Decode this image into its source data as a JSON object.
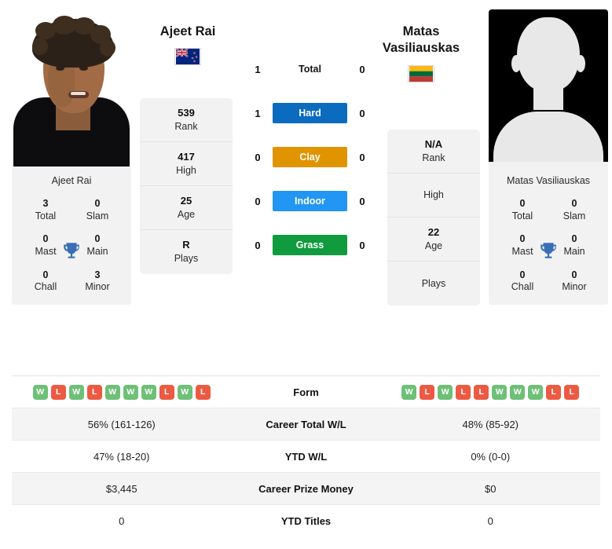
{
  "players": {
    "left": {
      "name": "Ajeet Rai",
      "photo_caption": "Ajeet Rai",
      "flag": "new-zealand-flag",
      "flag_country": "New Zealand",
      "titles": [
        {
          "value": "3",
          "label": "Total"
        },
        {
          "value": "0",
          "label": "Slam"
        },
        {
          "value": "0",
          "label": "Mast"
        },
        {
          "value": "0",
          "label": "Main"
        },
        {
          "value": "0",
          "label": "Chall"
        },
        {
          "value": "3",
          "label": "Minor"
        }
      ],
      "info": [
        {
          "value": "539",
          "label": "Rank"
        },
        {
          "value": "417",
          "label": "High"
        },
        {
          "value": "25",
          "label": "Age"
        },
        {
          "value": "R",
          "label": "Plays"
        }
      ],
      "form": [
        "W",
        "L",
        "W",
        "L",
        "W",
        "W",
        "W",
        "L",
        "W",
        "L"
      ],
      "career_total_wl": "56% (161-126)",
      "ytd_wl": "47% (18-20)",
      "career_prize_money": "$3,445",
      "ytd_titles": "0"
    },
    "right": {
      "name": "Matas Vasiliauskas",
      "name_line1": "Matas",
      "name_line2": "Vasiliauskas",
      "photo_caption": "Matas Vasiliauskas",
      "flag": "lithuania-flag",
      "flag_country": "Lithuania",
      "titles": [
        {
          "value": "0",
          "label": "Total"
        },
        {
          "value": "0",
          "label": "Slam"
        },
        {
          "value": "0",
          "label": "Mast"
        },
        {
          "value": "0",
          "label": "Main"
        },
        {
          "value": "0",
          "label": "Chall"
        },
        {
          "value": "0",
          "label": "Minor"
        }
      ],
      "info": [
        {
          "value": "N/A",
          "label": "Rank"
        },
        {
          "value": "",
          "label": "High"
        },
        {
          "value": "22",
          "label": "Age"
        },
        {
          "value": "",
          "label": "Plays"
        }
      ],
      "form": [
        "W",
        "L",
        "W",
        "L",
        "L",
        "W",
        "W",
        "W",
        "L",
        "L"
      ],
      "career_total_wl": "48% (85-92)",
      "ytd_wl": "0% (0-0)",
      "career_prize_money": "$0",
      "ytd_titles": "0"
    }
  },
  "head_to_head": [
    {
      "label": "Total",
      "left": "1",
      "right": "0",
      "badge": false,
      "color": ""
    },
    {
      "label": "Hard",
      "left": "1",
      "right": "0",
      "badge": true,
      "color": "#0B6BBF"
    },
    {
      "label": "Clay",
      "left": "0",
      "right": "0",
      "badge": true,
      "color": "#E09400"
    },
    {
      "label": "Indoor",
      "left": "0",
      "right": "0",
      "badge": true,
      "color": "#2196F3"
    },
    {
      "label": "Grass",
      "left": "0",
      "right": "0",
      "badge": true,
      "color": "#109B3E"
    }
  ],
  "comparison_rows": [
    {
      "label": "Form",
      "type": "form"
    },
    {
      "label": "Career Total W/L",
      "type": "text",
      "left": "56% (161-126)",
      "right": "48% (85-92)"
    },
    {
      "label": "YTD W/L",
      "type": "text",
      "left": "47% (18-20)",
      "right": "0% (0-0)"
    },
    {
      "label": "Career Prize Money",
      "type": "text",
      "left": "$3,445",
      "right": "$0"
    },
    {
      "label": "YTD Titles",
      "type": "text",
      "left": "0",
      "right": "0"
    }
  ],
  "colors": {
    "win": "#6ec077",
    "loss": "#ec5a43",
    "hard": "#0B6BBF",
    "clay": "#E09400",
    "indoor": "#2196F3",
    "grass": "#109B3E",
    "trophy": "#3a6fb5",
    "panel": "#f2f2f2",
    "row_alt": "#f4f4f4"
  },
  "icons": {
    "trophy": "trophy-icon"
  }
}
